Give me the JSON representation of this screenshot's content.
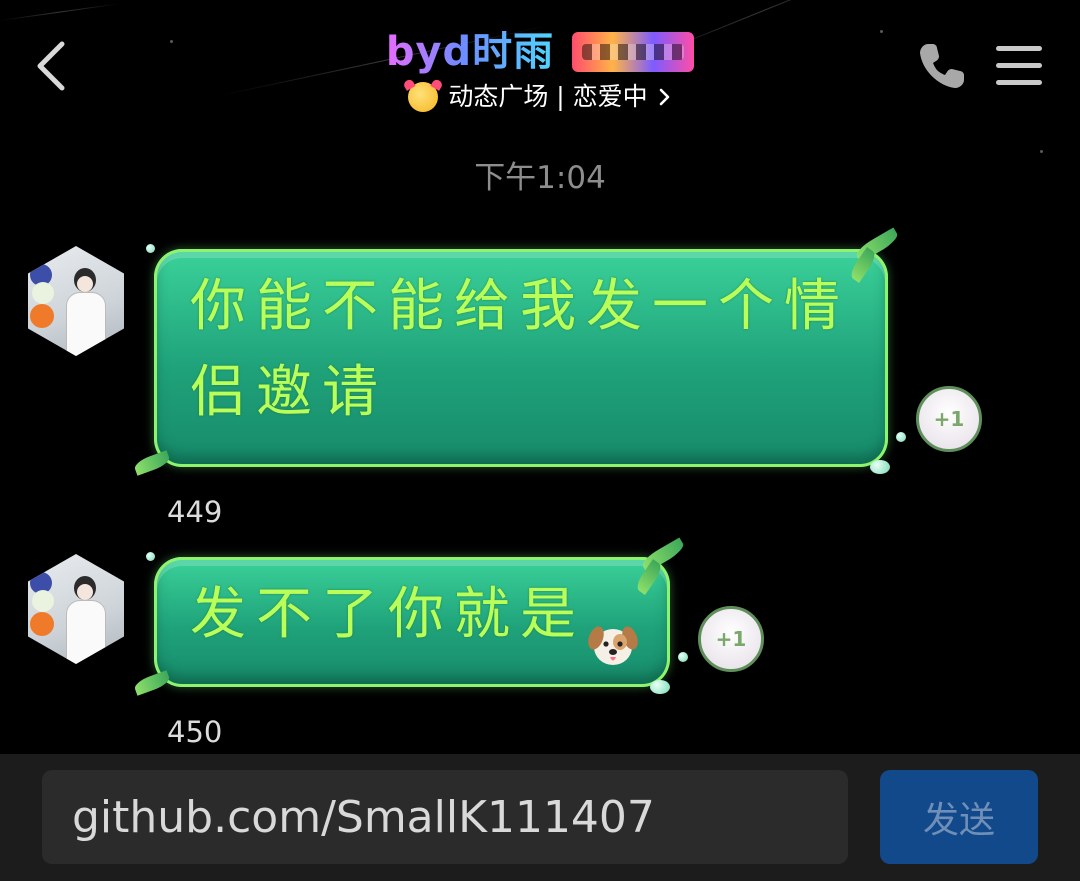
{
  "header": {
    "contact_name": "byd时雨",
    "status_text": "动态广场 | 恋爱中",
    "icons": {
      "back": "chevron-left-icon",
      "call": "phone-icon",
      "menu": "hamburger-menu-icon",
      "status_emoji": "smiling-face-with-hearts-icon",
      "status_chevron": "chevron-right-icon",
      "badge": "level-badge-icon"
    }
  },
  "timestamp": "下午1:04",
  "messages": [
    {
      "text": "你能不能给我发一个情侣邀请",
      "id_label": "449",
      "plus_one": "+1"
    },
    {
      "text": "发不了你就是",
      "id_label": "450",
      "plus_one": "+1",
      "trailing_emoji": "dog-face-icon"
    }
  ],
  "input_bar": {
    "value": "github.com/SmallK111407",
    "send_label": "发送"
  },
  "colors": {
    "background": "#000000",
    "bubble_green": "#1fa27a",
    "bubble_text": "#b8ff5a",
    "send_button": "#11498a",
    "input_background": "#2b2b2b"
  }
}
